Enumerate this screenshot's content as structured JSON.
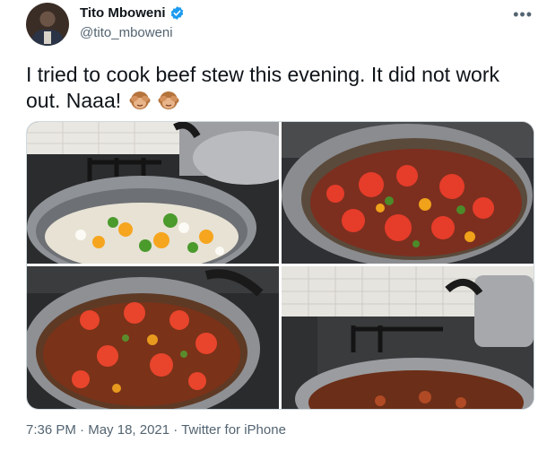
{
  "author": {
    "name": "Tito Mboweni",
    "handle": "@tito_mboweni",
    "verified": true
  },
  "tweet": {
    "text": "I tried to cook beef stew this evening. It did not work out. Naaa!",
    "emoji": [
      "see-no-evil-monkey",
      "see-no-evil-monkey"
    ]
  },
  "media": {
    "photos": [
      {
        "name": "photo-raw-vegetables-in-pot"
      },
      {
        "name": "photo-tomatoes-in-pot"
      },
      {
        "name": "photo-simmering-stew"
      },
      {
        "name": "photo-stew-on-stove"
      }
    ]
  },
  "footer": {
    "time": "7:36 PM",
    "separator": " · ",
    "date": "May 18, 2021",
    "source": "Twitter for iPhone"
  },
  "colors": {
    "verified_blue": "#1d9bf0",
    "secondary_text": "#536471",
    "primary_text": "#0f1419"
  }
}
